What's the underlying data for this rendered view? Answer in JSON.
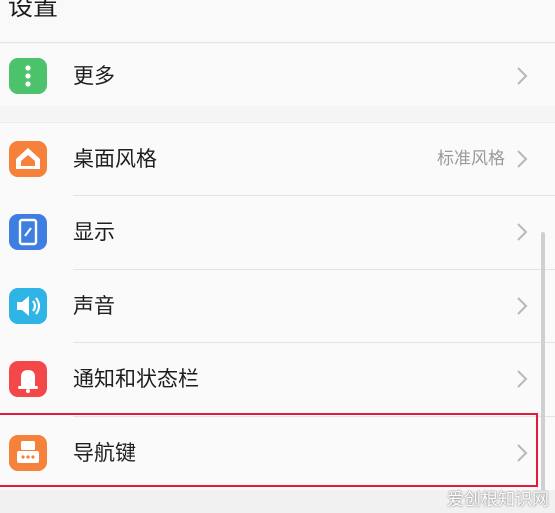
{
  "header": {
    "title": "设置"
  },
  "top_group": [
    {
      "label": "更多",
      "icon": "more-dots-icon",
      "color": "#4cc36a"
    }
  ],
  "main_group": [
    {
      "label": "桌面风格",
      "value": "标准风格",
      "icon": "home-icon",
      "color": "#f5813a"
    },
    {
      "label": "显示",
      "value": "",
      "icon": "display-icon",
      "color": "#3d7ee0"
    },
    {
      "label": "声音",
      "value": "",
      "icon": "speaker-icon",
      "color": "#2fb4e6"
    },
    {
      "label": "通知和状态栏",
      "value": "",
      "icon": "bell-icon",
      "color": "#f4474a"
    },
    {
      "label": "导航键",
      "value": "",
      "icon": "navigation-key-icon",
      "color": "#f5813a"
    }
  ],
  "highlight_color": "#e11b3b",
  "watermark": "爱创根知识网"
}
